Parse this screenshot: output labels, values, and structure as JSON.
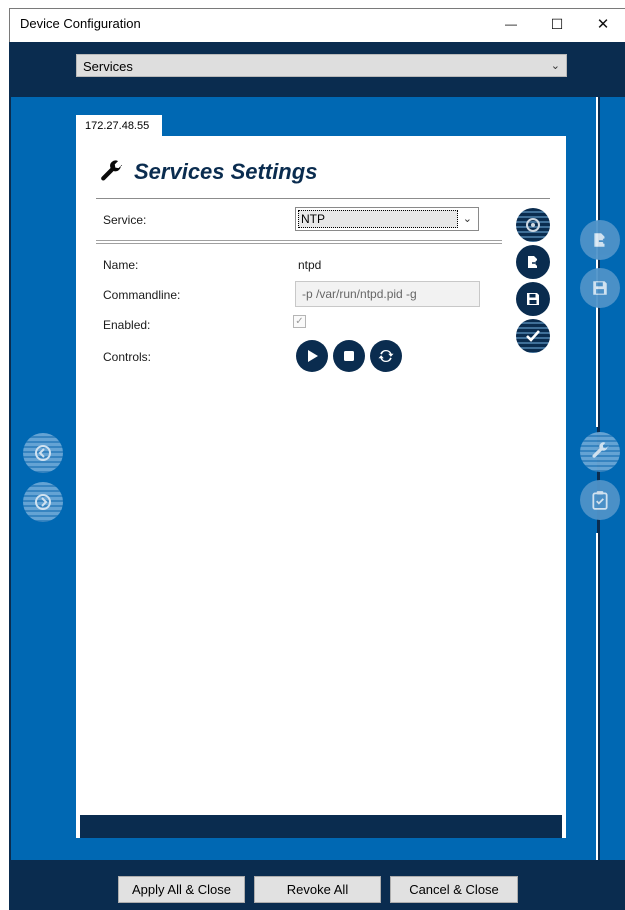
{
  "window": {
    "title": "Device Configuration",
    "controls": {
      "minimize": "—",
      "maximize": "☐",
      "close": "✕"
    }
  },
  "top_select": {
    "value": "Services"
  },
  "tab": {
    "label": "172.27.48.55"
  },
  "header": {
    "title": "Services Settings",
    "icon": "wrench-icon"
  },
  "form": {
    "service_label": "Service:",
    "service_value": "NTP",
    "name_label": "Name:",
    "name_value": "ntpd",
    "commandline_label": "Commandline:",
    "commandline_value": "-p /var/run/ntpd.pid -g",
    "enabled_label": "Enabled:",
    "enabled_checked": true,
    "controls_label": "Controls:"
  },
  "footer": {
    "apply_label": "Apply All & Close",
    "revoke_label": "Revoke All",
    "cancel_label": "Cancel & Close"
  },
  "colors": {
    "navy": "#0a2c4f",
    "blue": "#0068b3",
    "faded_blue": "#4f93c9"
  }
}
